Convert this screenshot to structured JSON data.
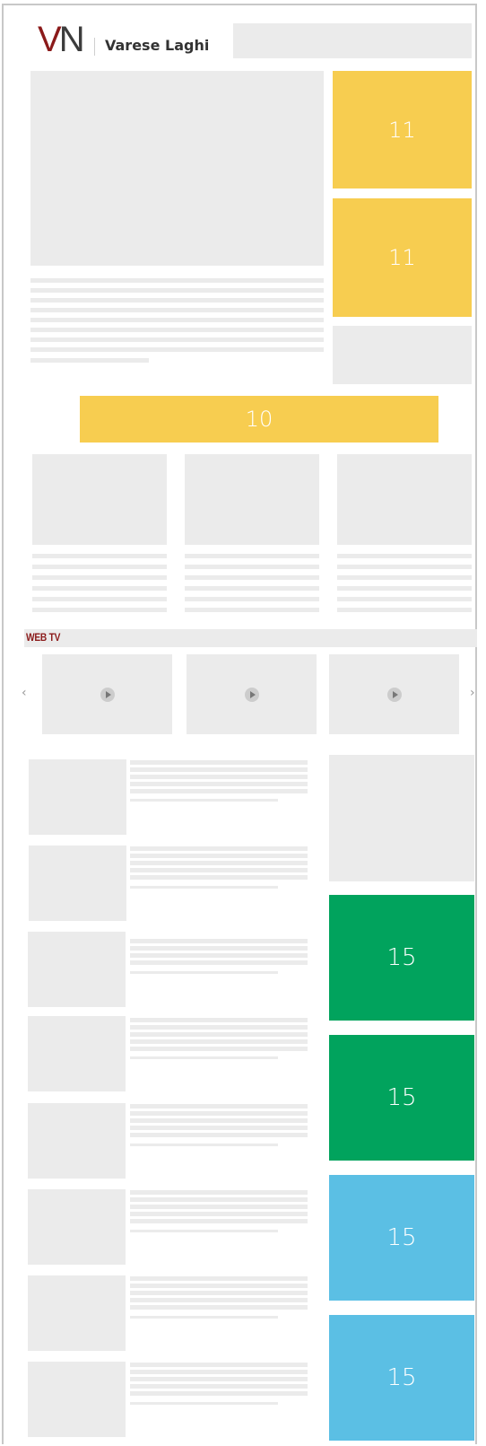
{
  "header": {
    "logo_v": "V",
    "logo_n": "N",
    "site_name": "Varese Laghi"
  },
  "slots": {
    "top_right_1": "11",
    "top_right_2": "11",
    "middle_banner": "10",
    "side_green_1": "15",
    "side_green_2": "15",
    "side_blue_1": "15",
    "side_blue_2": "15"
  },
  "webtv": {
    "title": "WEB TV",
    "prev_icon": "chevron-left-icon",
    "next_icon": "chevron-right-icon",
    "video_icon": "play-icon"
  },
  "colors": {
    "yellow": "#f7cd50",
    "green": "#01a35d",
    "blue": "#5bbfe4",
    "brand": "#8b1a1a",
    "placeholder": "#ebebeb"
  }
}
